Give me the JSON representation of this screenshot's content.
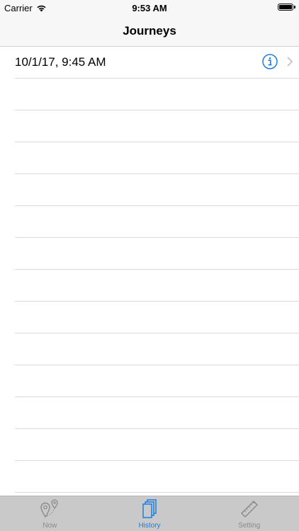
{
  "status_bar": {
    "carrier": "Carrier",
    "time": "9:53 AM"
  },
  "nav_bar": {
    "title": "Journeys"
  },
  "journeys": [
    {
      "label": "10/1/17, 9:45 AM"
    }
  ],
  "tab_bar": {
    "tabs": [
      {
        "label": "Now",
        "icon": "map-pin-icon",
        "active": false
      },
      {
        "label": "History",
        "icon": "stacked-pages-icon",
        "active": true
      },
      {
        "label": "Setting",
        "icon": "ruler-icon",
        "active": false
      }
    ]
  },
  "colors": {
    "accent": "#1a7ee6",
    "inactive_tab": "#8a8a8a",
    "tab_bar_bg": "#c9c9c9"
  }
}
